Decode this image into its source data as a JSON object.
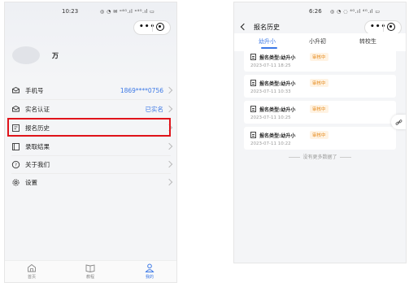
{
  "left_screen": {
    "status_time": "10:23",
    "status_icons": "◎ ◔ ✉ ᵒ⁴ᴳ.ıl ᵒ⁴ᴳ.ıl ▭",
    "capsule_dots": "•••",
    "username": "万",
    "menu": [
      {
        "label": "手机号",
        "value": "1869****0756"
      },
      {
        "label": "实名认证",
        "value": "已实名"
      },
      {
        "label": "报名历史",
        "value": ""
      },
      {
        "label": "录取结果",
        "value": ""
      },
      {
        "label": "关于我们",
        "value": ""
      },
      {
        "label": "设置",
        "value": ""
      }
    ],
    "tabbar": [
      {
        "label": "首页"
      },
      {
        "label": "教程"
      },
      {
        "label": "我的"
      }
    ]
  },
  "right_screen": {
    "status_time": "6:26",
    "status_icons": "◎ ◔ ◌ ⁴ᴳ.ıl ⁴ᴳ.ıl ▭",
    "capsule_dots": "•••",
    "title": "报名历史",
    "tabs": [
      "幼升小",
      "小升初",
      "转校生"
    ],
    "active_tab": 0,
    "records": [
      {
        "type": "报名类型:幼升小",
        "status": "审核中",
        "date": "2023-07-11 18:25"
      },
      {
        "type": "报名类型:幼升小",
        "status": "审核中",
        "date": "2023-07-11 10:33"
      },
      {
        "type": "报名类型:幼升小",
        "status": "审核中",
        "date": "2023-07-11 10:25"
      },
      {
        "type": "报名类型:幼升小",
        "status": "审核中",
        "date": "2023-07-11 10:22"
      }
    ],
    "no_more": "没有更多数据了",
    "float_icon": "link-icon"
  },
  "colors": {
    "accent": "#3b78e6",
    "highlight": "#e0141b",
    "badge_text": "#e5891a",
    "badge_bg": "#fff3e3"
  }
}
